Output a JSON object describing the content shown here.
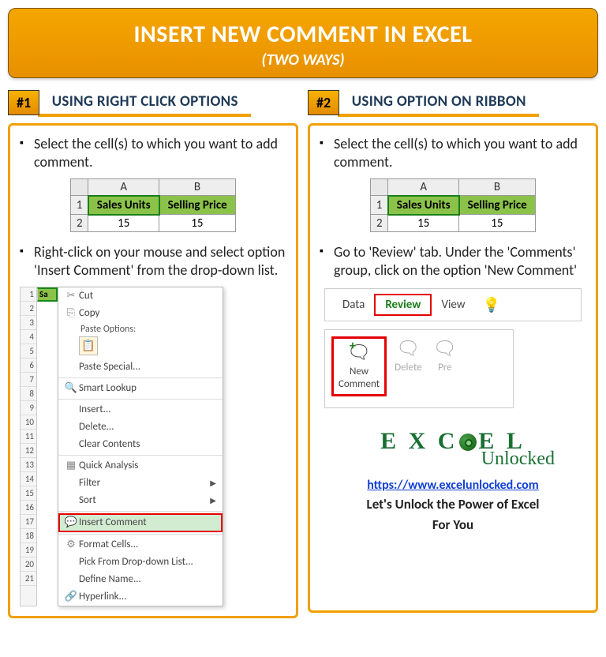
{
  "header": {
    "title": "INSERT NEW COMMENT IN EXCEL",
    "subtitle": "(TWO WAYS)"
  },
  "method1": {
    "badge": "#1",
    "title": "USING RIGHT CLICK OPTIONS",
    "step1": "Select the cell(s) to which you want to add comment.",
    "step2": "Right-click on your mouse and select option 'Insert Comment' from the drop-down list.",
    "table": {
      "colA": "A",
      "colB": "B",
      "row1": "1",
      "row2": "2",
      "h1": "Sales Units",
      "h2": "Selling Price",
      "v1": "15",
      "v2": "15"
    },
    "rows": [
      "1",
      "2",
      "3",
      "4",
      "5",
      "6",
      "7",
      "8",
      "9",
      "10",
      "11",
      "12",
      "13",
      "14",
      "15",
      "16",
      "17",
      "18",
      "19",
      "20",
      "21"
    ],
    "selhead": "Sa",
    "ctx": {
      "cut": "Cut",
      "copy": "Copy",
      "paste_h": "Paste Options:",
      "paste_special": "Paste Special...",
      "smart": "Smart Lookup",
      "insert": "Insert...",
      "delete": "Delete...",
      "clear": "Clear Contents",
      "quick": "Quick Analysis",
      "filter": "Filter",
      "sort": "Sort",
      "insert_comment": "Insert Comment",
      "format": "Format Cells...",
      "pick": "Pick From Drop-down List...",
      "define": "Define Name...",
      "hyper": "Hyperlink..."
    }
  },
  "method2": {
    "badge": "#2",
    "title": "USING OPTION ON RIBBON",
    "step1": "Select the cell(s) to which you want to add comment.",
    "step2": "Go to 'Review' tab. Under the 'Comments' group, click on the option 'New Comment'",
    "table": {
      "colA": "A",
      "colB": "B",
      "row1": "1",
      "row2": "2",
      "h1": "Sales Units",
      "h2": "Selling Price",
      "v1": "15",
      "v2": "15"
    },
    "tabs": {
      "data": "Data",
      "review": "Review",
      "view": "View"
    },
    "buttons": {
      "new1": "New",
      "new2": "Comment",
      "delete": "Delete",
      "prev": "Pre"
    },
    "logo": {
      "part1": "E X C",
      "part2": "E L",
      "sub": "Unlocked"
    },
    "url": "https://www.excelunlocked.com",
    "tag1": "Let's Unlock the Power of Excel",
    "tag2": "For You"
  }
}
